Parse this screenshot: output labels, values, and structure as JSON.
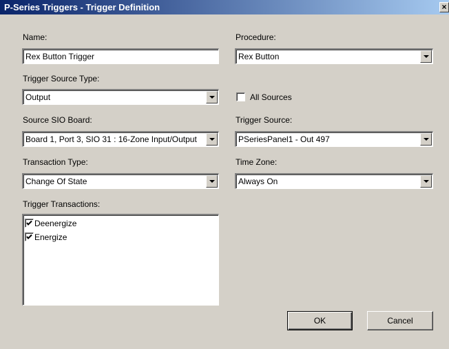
{
  "window": {
    "title": "P-Series Triggers - Trigger Definition",
    "close_glyph": "×"
  },
  "name": {
    "label": "Name:",
    "value": "Rex Button Trigger"
  },
  "procedure": {
    "label": "Procedure:",
    "value": "Rex Button"
  },
  "trigger_source_type": {
    "label": "Trigger Source Type:",
    "value": "Output"
  },
  "all_sources": {
    "label": "All Sources",
    "checked": false
  },
  "source_sio_board": {
    "label": "Source SIO Board:",
    "value": "Board 1, Port 3, SIO 31 : 16-Zone Input/Output"
  },
  "trigger_source": {
    "label": "Trigger Source:",
    "value": "PSeriesPanel1 - Out 497"
  },
  "transaction_type": {
    "label": "Transaction Type:",
    "value": "Change Of State"
  },
  "time_zone": {
    "label": "Time Zone:",
    "value": "Always On"
  },
  "trigger_transactions": {
    "label": "Trigger Transactions:",
    "items": [
      {
        "label": "Deenergize",
        "checked": true
      },
      {
        "label": "Energize",
        "checked": true
      }
    ]
  },
  "buttons": {
    "ok": "OK",
    "cancel": "Cancel"
  }
}
